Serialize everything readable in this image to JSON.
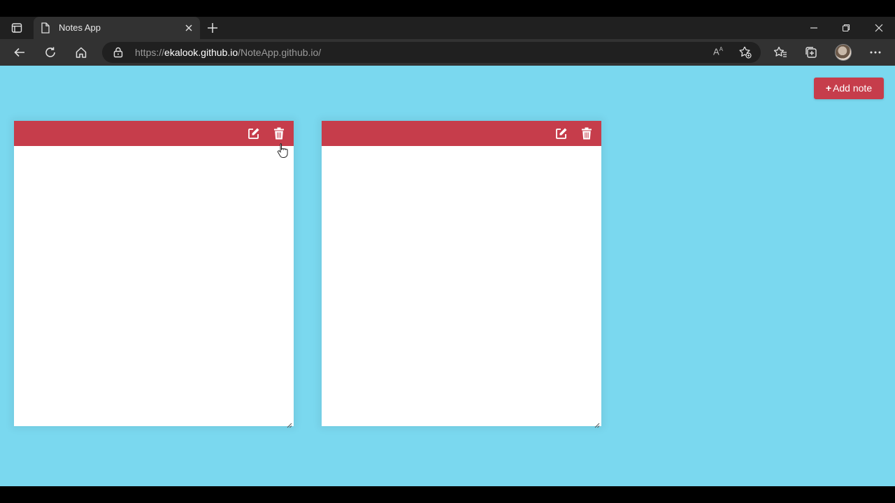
{
  "browser": {
    "tab": {
      "title": "Notes App",
      "favicon": "page-icon"
    },
    "address": {
      "scheme": "https://",
      "host": "ekalook.github.io",
      "path": "/NoteApp.github.io/"
    },
    "read_aloud_label": "A",
    "icons": {
      "tab_actions": "tab-actions-icon",
      "tab_close": "close-icon",
      "new_tab": "plus-icon",
      "minimize": "minimize-icon",
      "restore": "restore-icon",
      "close_window": "close-icon",
      "back": "back-arrow-icon",
      "refresh": "refresh-icon",
      "home": "home-icon",
      "lock": "lock-icon",
      "read_aloud": "read-aloud-icon",
      "add_favorite": "add-favorite-icon",
      "favorites": "favorites-icon",
      "collections": "collections-icon",
      "profile": "avatar",
      "menu": "more-icon"
    }
  },
  "app": {
    "add_note_button": {
      "icon": "+",
      "label": "Add note"
    },
    "notes": [
      {
        "text": ""
      },
      {
        "text": ""
      }
    ],
    "colors": {
      "background": "#7ad8ef",
      "note_header": "#c63d4b",
      "button": "#c63d4b",
      "note_body": "#ffffff"
    }
  }
}
